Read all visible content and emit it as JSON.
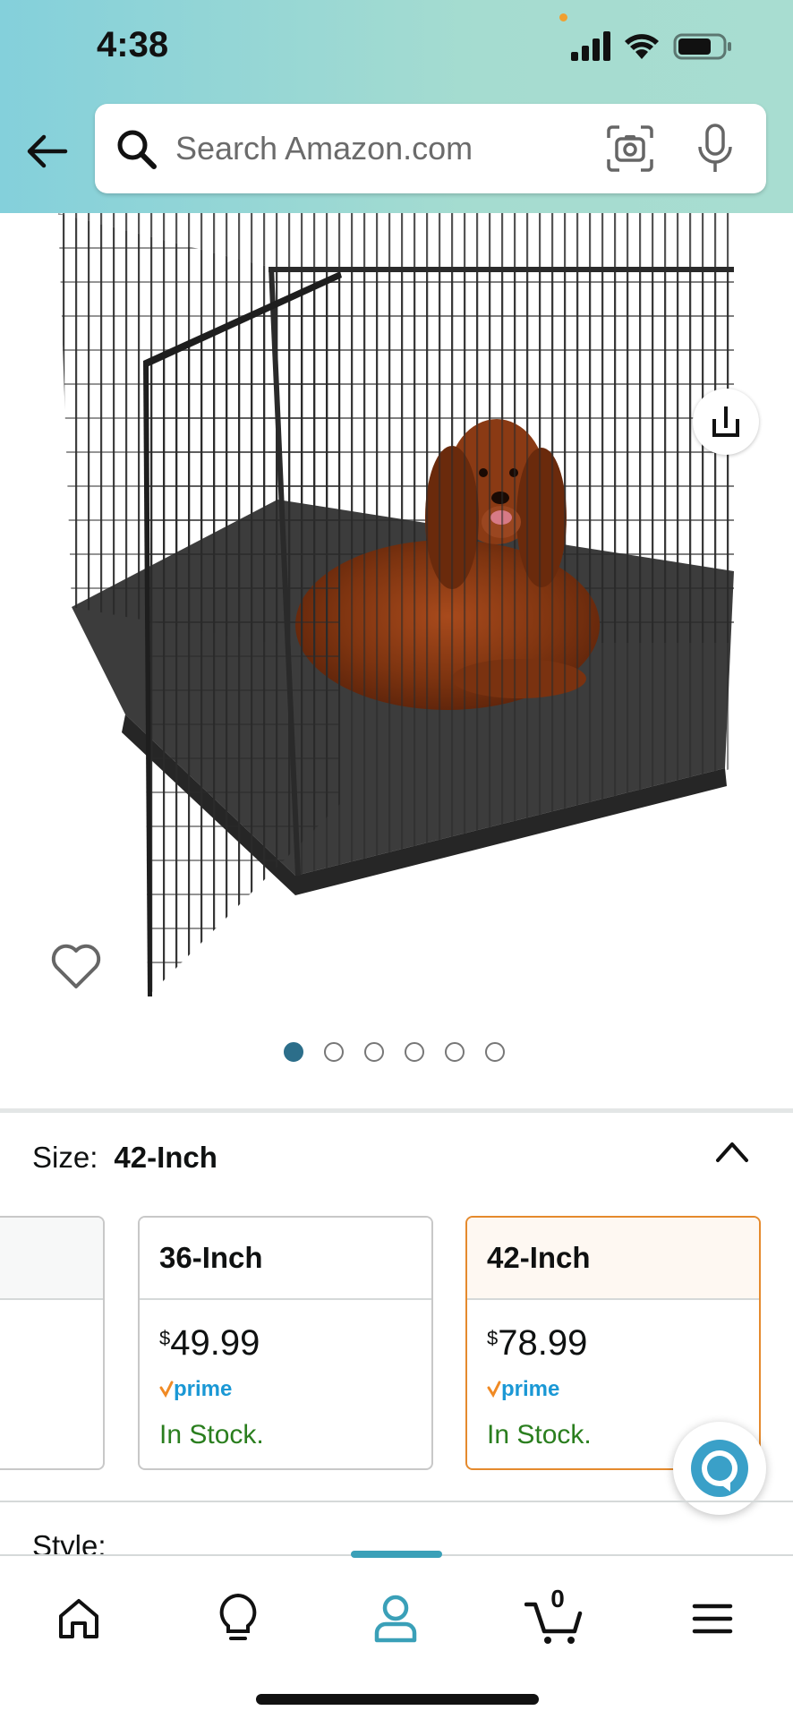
{
  "status_bar": {
    "time": "4:38"
  },
  "search": {
    "placeholder": "Search Amazon.com"
  },
  "gallery": {
    "image_count": 6,
    "active_index": 0
  },
  "size": {
    "label": "Size:",
    "selected": "42-Inch",
    "options": [
      {
        "name": "",
        "price_symbol": "",
        "price": "",
        "prime": false,
        "stock": ""
      },
      {
        "name": "36-Inch",
        "price_symbol": "$",
        "price": "49.99",
        "prime": true,
        "stock": "In Stock."
      },
      {
        "name": "42-Inch",
        "price_symbol": "$",
        "price": "78.99",
        "prime": true,
        "stock": "In Stock."
      }
    ]
  },
  "style": {
    "label": "Style:"
  },
  "prime_label": "prime",
  "cart": {
    "count": "0"
  },
  "colors": {
    "header_gradient_start": "#84d0db",
    "header_gradient_end": "#a8ddd1",
    "selected_border": "#e58a2d",
    "in_stock": "#2a7e1e",
    "prime_blue": "#1a98d5",
    "active_nav": "#3aa0b8"
  },
  "icons": [
    "back-arrow-icon",
    "search-icon",
    "camera-icon",
    "microphone-icon",
    "share-icon",
    "heart-icon",
    "chevron-up-icon",
    "alexa-icon",
    "home-icon",
    "lightbulb-icon",
    "account-icon",
    "cart-icon",
    "menu-icon"
  ]
}
